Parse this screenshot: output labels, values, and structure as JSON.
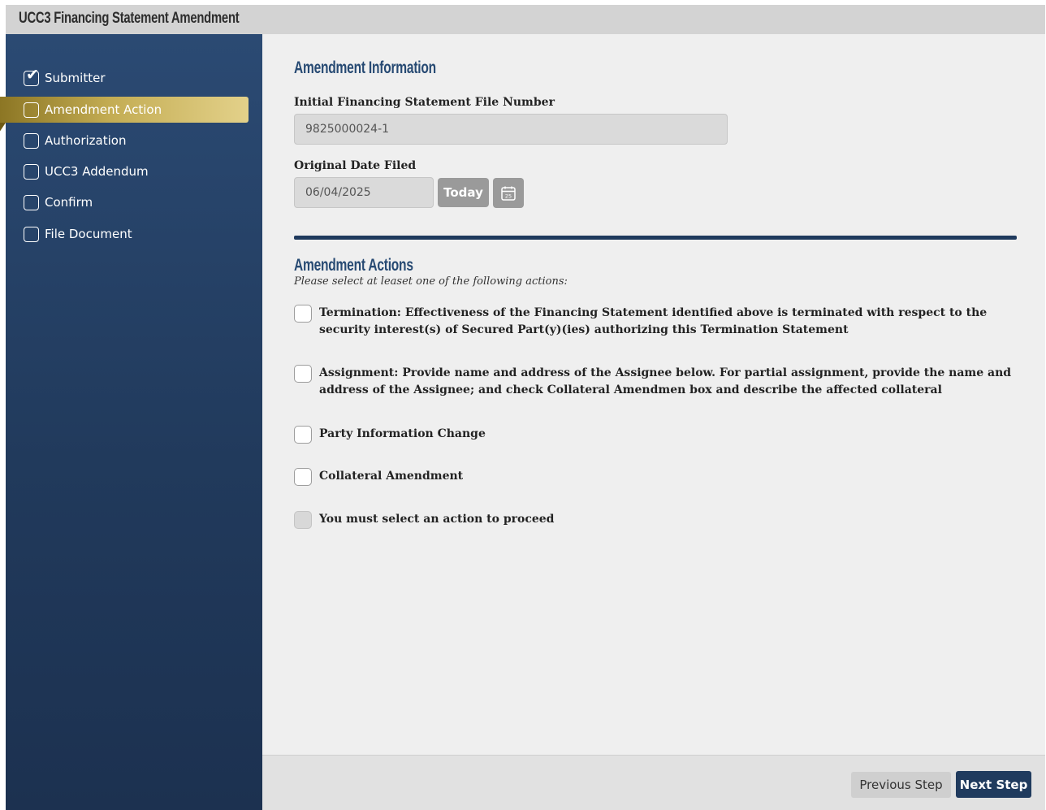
{
  "window": {
    "title": "UCC3 Financing Statement Amendment"
  },
  "sidebar": {
    "steps": [
      {
        "label": "Submitter",
        "checked": true,
        "active": false
      },
      {
        "label": "Amendment Action",
        "checked": false,
        "active": true
      },
      {
        "label": "Authorization",
        "checked": false,
        "active": false
      },
      {
        "label": "UCC3 Addendum",
        "checked": false,
        "active": false
      },
      {
        "label": "Confirm",
        "checked": false,
        "active": false
      },
      {
        "label": "File Document",
        "checked": false,
        "active": false
      }
    ],
    "check_icon": "check-icon"
  },
  "amendment_info": {
    "heading": "Amendment Information",
    "file_number_label": "Initial Financing Statement File Number",
    "file_number_value": "9825000024-1",
    "date_label": "Original Date Filed",
    "date_value": "06/04/2025",
    "today_label": "Today",
    "calendar_day": "25"
  },
  "amendment_actions": {
    "heading": "Amendment Actions",
    "instruction": "Please select at leaset one of the following actions:",
    "options": [
      {
        "label": "Termination: Effectiveness of the Financing Statement identified above is terminated with respect to the security interest(s) of Secured Part(y)(ies) authorizing this Termination Statement",
        "checked": false,
        "disabled": false
      },
      {
        "label": "Assignment: Provide name and address of the Assignee below. For partial assignment, provide the name and address of the Assignee; and check Collateral Amendmen box and describe the affected collateral",
        "checked": false,
        "disabled": false
      },
      {
        "label": "Party Information Change",
        "checked": false,
        "disabled": false
      },
      {
        "label": "Collateral Amendment",
        "checked": false,
        "disabled": false
      },
      {
        "label": "You must select an action to proceed",
        "checked": false,
        "disabled": true
      }
    ]
  },
  "footer": {
    "previous_label": "Previous Step",
    "next_label": "Next Step"
  },
  "colors": {
    "sidebar": "#213a5c",
    "active_step": "#c4ad54",
    "heading": "#274a73",
    "primary_button": "#203b5e"
  }
}
